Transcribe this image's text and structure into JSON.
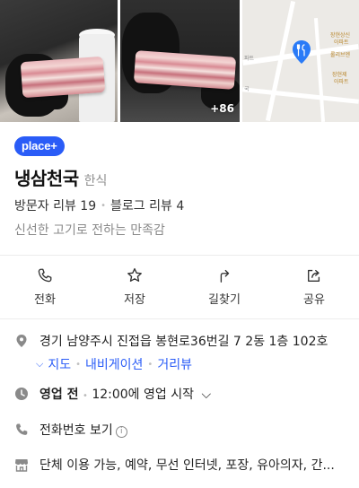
{
  "gallery": {
    "more_count": "+86"
  },
  "map": {
    "labels": [
      "장현상신",
      "아파트",
      "롤리브엔",
      "장현제",
      "아파트",
      "파트",
      "국"
    ]
  },
  "badge": "place+",
  "place": {
    "name": "냉삼천국",
    "category": "한식",
    "visitor_reviews": "방문자 리뷰 19",
    "blog_reviews": "블로그 리뷰 4",
    "tagline": "신선한 고기로 전하는 만족감"
  },
  "actions": [
    {
      "label": "전화",
      "icon": "phone-icon"
    },
    {
      "label": "저장",
      "icon": "star-icon"
    },
    {
      "label": "길찾기",
      "icon": "directions-icon"
    },
    {
      "label": "공유",
      "icon": "share-icon"
    }
  ],
  "address": {
    "text": "경기 남양주시 진접읍 봉현로36번길 7 2동 1층 102호",
    "links": [
      "지도",
      "내비게이션",
      "거리뷰"
    ]
  },
  "hours": {
    "status": "영업 전",
    "next": "12:00에 영업 시작"
  },
  "phone": {
    "label": "전화번호 보기"
  },
  "amenities": {
    "text": "단체 이용 가능, 예약, 무선 인터넷, 포장, 유아의자, 간..."
  },
  "colors": {
    "accent": "#2a5cf7",
    "pin": "#2a7bf7"
  }
}
